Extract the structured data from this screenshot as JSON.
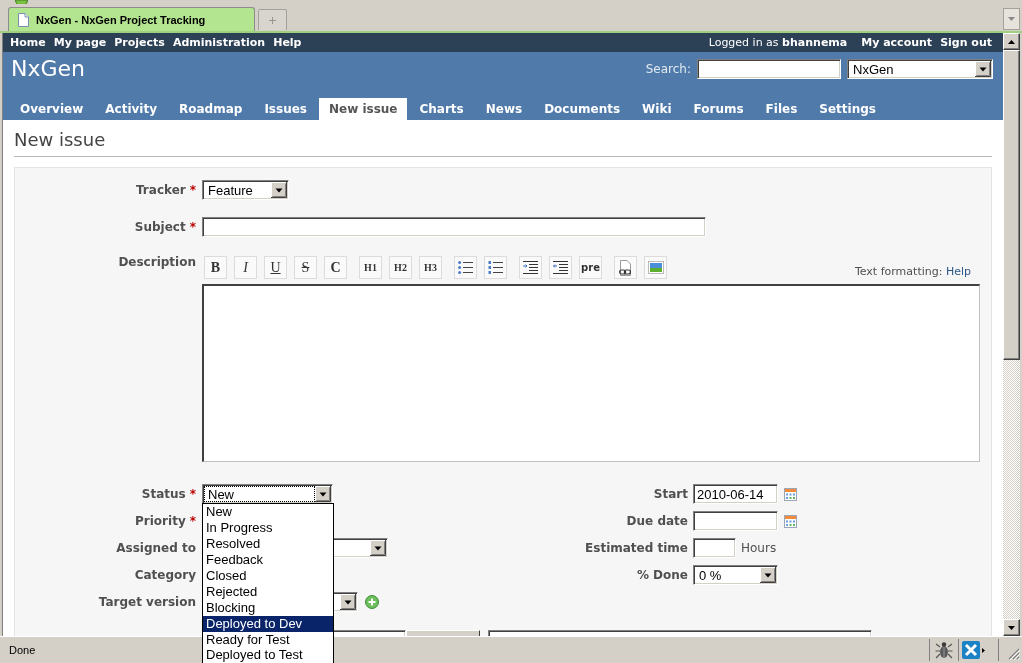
{
  "browser": {
    "tabs": [
      {
        "title": "NxGen - NxGen Project Tracking",
        "selected": true
      }
    ],
    "status_text": "Done"
  },
  "top_menu": {
    "items": [
      "Home",
      "My page",
      "Projects",
      "Administration",
      "Help"
    ],
    "logged_in": "Logged in as **bhannema**",
    "account_items": [
      "My account",
      "Sign out"
    ]
  },
  "header": {
    "title": "NxGen",
    "search_label": "Search:",
    "project_select": "NxGen"
  },
  "main_menu": [
    {
      "label": "Overview",
      "selected": false
    },
    {
      "label": "Activity",
      "selected": false
    },
    {
      "label": "Roadmap",
      "selected": false
    },
    {
      "label": "Issues",
      "selected": false
    },
    {
      "label": "New issue",
      "selected": true
    },
    {
      "label": "Charts",
      "selected": false
    },
    {
      "label": "News",
      "selected": false
    },
    {
      "label": "Documents",
      "selected": false
    },
    {
      "label": "Wiki",
      "selected": false
    },
    {
      "label": "Forums",
      "selected": false
    },
    {
      "label": "Files",
      "selected": false
    },
    {
      "label": "Settings",
      "selected": false
    }
  ],
  "page_title": "New issue",
  "form": {
    "tracker": {
      "label": "Tracker",
      "required_mark": "*",
      "value": "Feature"
    },
    "subject": {
      "label": "Subject",
      "required_mark": "*"
    },
    "description": {
      "label": "Description",
      "toolbar": [
        {
          "kind": "bold",
          "label": "B"
        },
        {
          "kind": "italic",
          "label": "I"
        },
        {
          "kind": "underline",
          "label": "U"
        },
        {
          "kind": "strike",
          "label": "S"
        },
        {
          "kind": "code",
          "label": "C"
        },
        {
          "kind": "heading",
          "label": "H1"
        },
        {
          "kind": "heading",
          "label": "H2"
        },
        {
          "kind": "heading",
          "label": "H3"
        },
        {
          "kind": "bullet-list"
        },
        {
          "kind": "numbered-list"
        },
        {
          "kind": "indent"
        },
        {
          "kind": "outdent"
        },
        {
          "kind": "pre",
          "label": "pre"
        },
        {
          "kind": "link"
        },
        {
          "kind": "image"
        }
      ],
      "formatting_hint": "Text formatting:",
      "help_link": "Help"
    },
    "status": {
      "label": "Status",
      "required_mark": "*",
      "value": "New",
      "focused": true
    },
    "priority": {
      "label": "Priority",
      "required_mark": "*"
    },
    "assigned_to": {
      "label": "Assigned to"
    },
    "category": {
      "label": "Category"
    },
    "target_version": {
      "label": "Target version"
    },
    "start_date": {
      "label": "Start",
      "value": "2010-06-14"
    },
    "due_date": {
      "label": "Due date"
    },
    "estimated_time": {
      "label": "Estimated time",
      "unit": "Hours"
    },
    "done_ratio": {
      "label": "% Done",
      "value": "0 %"
    }
  },
  "status_dropdown": {
    "options": [
      {
        "label": "New",
        "selected": false
      },
      {
        "label": "In Progress",
        "selected": false
      },
      {
        "label": "Resolved",
        "selected": false
      },
      {
        "label": "Feedback",
        "selected": false
      },
      {
        "label": "Closed",
        "selected": false
      },
      {
        "label": "Rejected",
        "selected": false
      },
      {
        "label": "Blocking",
        "selected": false
      },
      {
        "label": "Deployed to Dev",
        "selected": true
      },
      {
        "label": "Ready for Test",
        "selected": false
      },
      {
        "label": "Deployed to Test",
        "selected": false
      }
    ]
  }
}
